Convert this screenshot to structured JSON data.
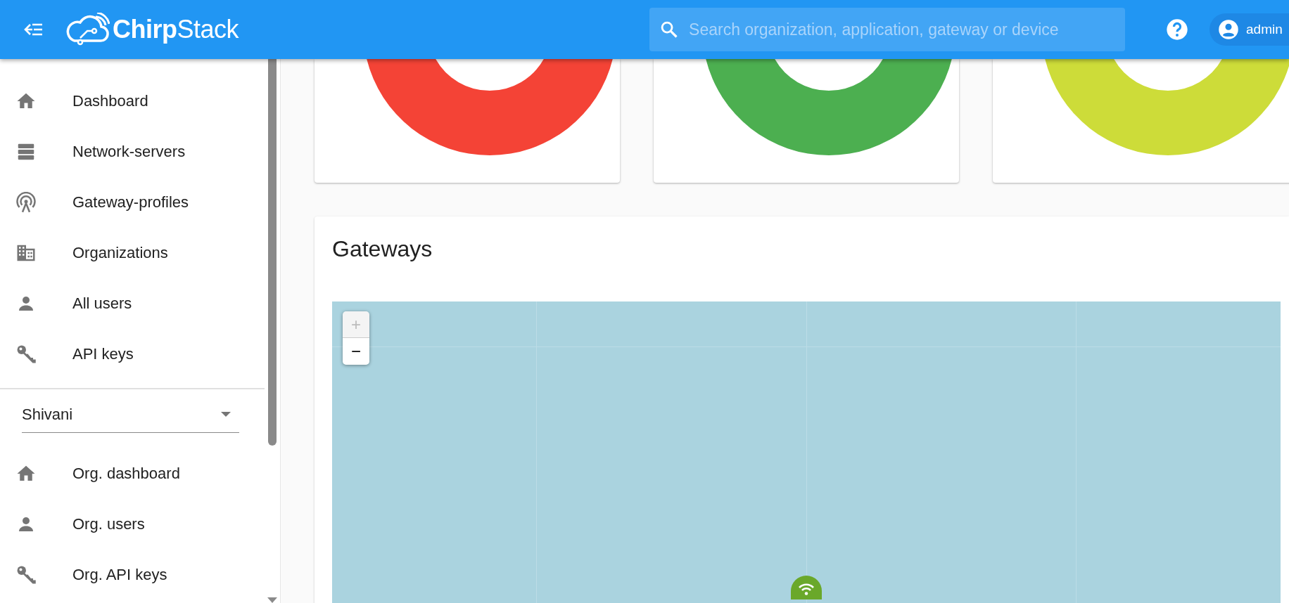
{
  "header": {
    "logo": "**Chirp**Stack",
    "search": {
      "placeholder": "Search organization, application, gateway or device"
    },
    "user": {
      "name": "admin"
    }
  },
  "sidebar": {
    "items": [
      {
        "kind": "home",
        "label": "Dashboard"
      },
      {
        "kind": "servers",
        "label": "Network-servers"
      },
      {
        "kind": "antenna",
        "label": "Gateway-profiles"
      },
      {
        "kind": "building",
        "label": "Organizations"
      },
      {
        "kind": "person",
        "label": "All users"
      },
      {
        "kind": "key",
        "label": "API keys"
      }
    ],
    "organization_select": {
      "value": "Shivani"
    },
    "org_items": [
      {
        "kind": "home",
        "label": "Org. dashboard"
      },
      {
        "kind": "person",
        "label": "Org. users"
      },
      {
        "kind": "key",
        "label": "Org. API keys"
      }
    ]
  },
  "donut_cards": [
    {
      "color": "#f44336"
    },
    {
      "color": "#4caf50"
    },
    {
      "color": "#cddc39"
    }
  ],
  "gateways_card": {
    "title": "Gateways",
    "map": {
      "zoom_in": {
        "label": "+",
        "disabled": true
      },
      "zoom_out": {
        "label": "−",
        "disabled": false
      }
    }
  }
}
